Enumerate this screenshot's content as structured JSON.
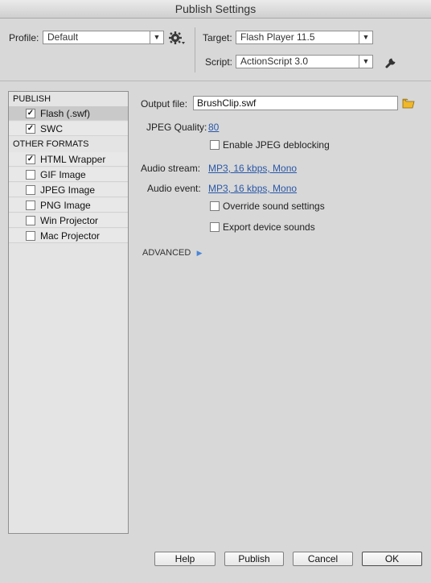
{
  "window": {
    "title": "Publish Settings"
  },
  "profile": {
    "label": "Profile:",
    "value": "Default"
  },
  "target": {
    "label": "Target:",
    "value": "Flash Player 11.5"
  },
  "script": {
    "label": "Script:",
    "value": "ActionScript 3.0"
  },
  "sidebar": {
    "publish_header": "PUBLISH",
    "publish_items": [
      {
        "label": "Flash (.swf)",
        "checked": true,
        "selected": true
      },
      {
        "label": "SWC",
        "checked": true,
        "selected": false
      }
    ],
    "other_header": "OTHER FORMATS",
    "other_items": [
      {
        "label": "HTML Wrapper",
        "checked": true
      },
      {
        "label": "GIF Image",
        "checked": false
      },
      {
        "label": "JPEG Image",
        "checked": false
      },
      {
        "label": "PNG Image",
        "checked": false
      },
      {
        "label": "Win Projector",
        "checked": false
      },
      {
        "label": "Mac Projector",
        "checked": false
      }
    ]
  },
  "main": {
    "output_file_label": "Output file:",
    "output_file_value": "BrushClip.swf",
    "jpeg_quality_label": "JPEG Quality:",
    "jpeg_quality_value": "80",
    "jpeg_deblocking_label": "Enable JPEG deblocking",
    "audio_stream_label": "Audio stream:",
    "audio_stream_value": "MP3, 16 kbps, Mono",
    "audio_event_label": "Audio event:",
    "audio_event_value": "MP3, 16 kbps, Mono",
    "override_sound_label": "Override sound settings",
    "export_device_label": "Export device sounds",
    "advanced_label": "ADVANCED"
  },
  "buttons": {
    "help": "Help",
    "publish": "Publish",
    "cancel": "Cancel",
    "ok": "OK"
  }
}
